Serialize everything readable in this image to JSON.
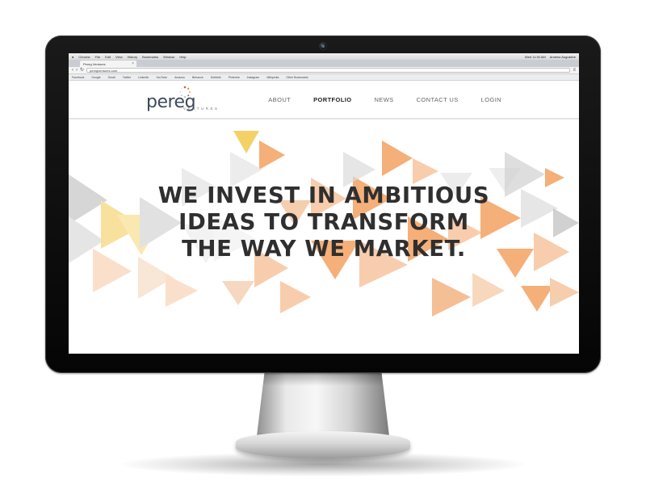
{
  "browser": {
    "menubar": {
      "items": [
        "Chrome",
        "File",
        "Edit",
        "View",
        "History",
        "Bookmarks",
        "Window",
        "Help"
      ],
      "clock": "Wed 11:30 AM",
      "user": "Andrew Augustine"
    },
    "tab_title": "Pereg Ventures",
    "url": "peregventures.com",
    "bookmarks": [
      "Facebook",
      "Google",
      "Gmail",
      "Twitter",
      "LinkedIn",
      "YouTube",
      "Amazon",
      "Behance",
      "Dribbble",
      "Pinterest",
      "Instagram",
      "Wikipedia",
      "Other Bookmarks"
    ]
  },
  "site": {
    "logo": {
      "word": "pereg",
      "sub": "VENTURES"
    },
    "nav": [
      {
        "label": "ABOUT"
      },
      {
        "label": "PORTFOLIO"
      },
      {
        "label": "NEWS"
      },
      {
        "label": "CONTACT US"
      },
      {
        "label": "LOGIN"
      }
    ],
    "active_nav": "PORTFOLIO",
    "headline": [
      "WE INVEST IN AMBITIOUS",
      "IDEAS TO TRANSFORM",
      "THE WAY WE MARKET."
    ]
  },
  "colors": {
    "orange": "#f4a261",
    "peach": "#f7c59f",
    "yellow": "#f2c94c",
    "gray": "#b8b8b8",
    "logo": "#3e4a5c"
  }
}
